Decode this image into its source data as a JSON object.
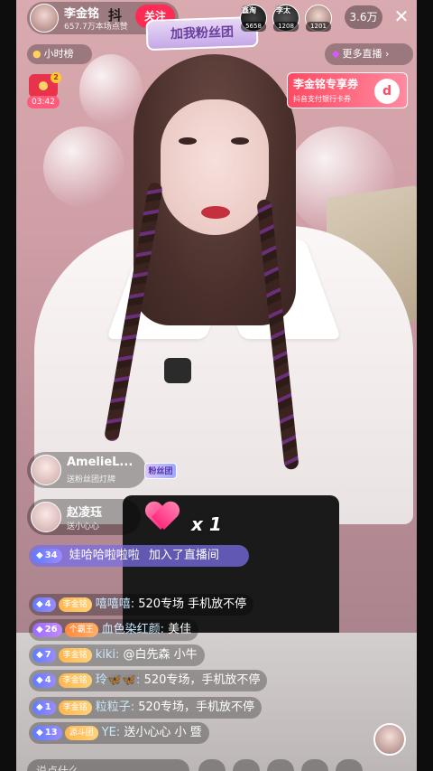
{
  "host": {
    "name": "李金铭",
    "sub": "657.7万本场点赞",
    "follow_label": "关注"
  },
  "logo_text": "抖",
  "fan_banner": "加我粉丝团",
  "viewers": [
    {
      "badge": "鑫淘",
      "count": "5658"
    },
    {
      "badge": "李太",
      "count": "1208"
    },
    {
      "badge": "",
      "count": "1201"
    }
  ],
  "online_count": "3.6万",
  "close_glyph": "✕",
  "hour_rank": {
    "icon": "●",
    "label": "小时榜"
  },
  "more_live": {
    "icon": "◆",
    "label": "更多直播 ›"
  },
  "red_packet": {
    "count": "2",
    "time": "03:42"
  },
  "coupon": {
    "title": "李金铭专享券",
    "sub": "抖音支付银行卡券",
    "icon": "d"
  },
  "gifts": [
    {
      "name": "AmelieL...",
      "desc": "送粉丝团灯牌",
      "badge": "粉丝团"
    },
    {
      "name": "赵凌珏",
      "desc": "送小心心"
    }
  ],
  "combo": "x 1",
  "join": {
    "level": "34",
    "user": "娃哈哈啦啦啦",
    "text": "加入了直播间"
  },
  "messages": [
    {
      "level": "4",
      "level_style": "blue",
      "tag": "李金铭",
      "tag_style": "yellow",
      "user": "嘻嘻嘻:",
      "text": "520专场 手机放不停"
    },
    {
      "level": "26",
      "level_style": "purple",
      "tag": "个霸王",
      "tag_style": "orange",
      "user": "血色染红颜:",
      "text": "美佳"
    },
    {
      "level": "7",
      "level_style": "blue",
      "tag": "李金铭",
      "tag_style": "yellow",
      "user": "kiki:",
      "text": "@白先森 小牛"
    },
    {
      "level": "4",
      "level_style": "blue",
      "tag": "李金铭",
      "tag_style": "yellow",
      "user": "玲🦋🦋:",
      "text": "520专场，手机放不停"
    },
    {
      "level": "1",
      "level_style": "blue",
      "tag": "李金铭",
      "tag_style": "yellow",
      "user": "粒粒子:",
      "text": "520专场，手机放不停"
    },
    {
      "level": "13",
      "level_style": "blue",
      "tag": "源斗团",
      "tag_style": "yellow",
      "user": "YE:",
      "text": "送小心心 小 暨"
    }
  ],
  "input_placeholder": "说点什么...",
  "colors": {
    "accent": "#fe2c55",
    "join_bg": "#786ee6"
  }
}
